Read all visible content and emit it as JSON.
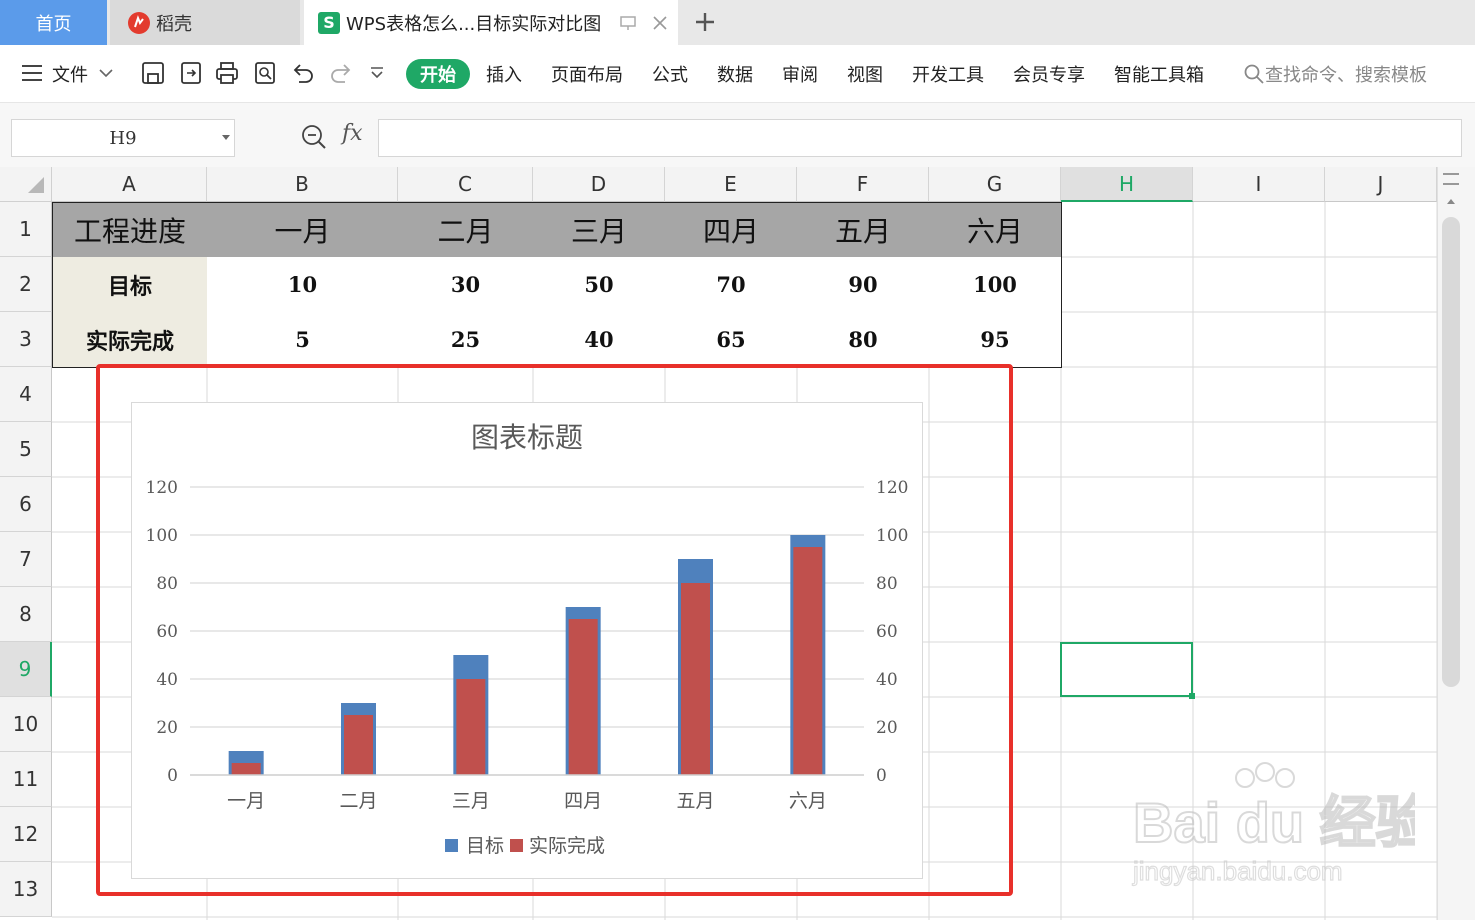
{
  "tabs": {
    "home": "首页",
    "daoke": "稻壳",
    "doc": "WPS表格怎么...目标实际对比图"
  },
  "menu": {
    "file": "文件",
    "start": "开始",
    "items": [
      "插入",
      "页面布局",
      "公式",
      "数据",
      "审阅",
      "视图",
      "开发工具",
      "会员专享",
      "智能工具箱"
    ],
    "search_placeholder": "查找命令、搜索模板"
  },
  "formula": {
    "cell_ref": "H9",
    "fx": "fx",
    "value": ""
  },
  "sheet": {
    "columns": [
      "A",
      "B",
      "C",
      "D",
      "E",
      "F",
      "G",
      "H",
      "I",
      "J"
    ],
    "active_column": "H",
    "rows": [
      "1",
      "2",
      "3",
      "4",
      "5",
      "6",
      "7",
      "8",
      "9",
      "10",
      "11",
      "12",
      "13"
    ],
    "active_row": "9",
    "table": {
      "header": [
        "工程进度",
        "一月",
        "二月",
        "三月",
        "四月",
        "五月",
        "六月"
      ],
      "target_label": "目标",
      "target": [
        "10",
        "30",
        "50",
        "70",
        "90",
        "100"
      ],
      "actual_label": "实际完成",
      "actual": [
        "5",
        "25",
        "40",
        "65",
        "80",
        "95"
      ]
    }
  },
  "colors": {
    "accent_green": "#1fa866",
    "target_series": "#4f81bd",
    "actual_series": "#c0504d",
    "highlight": "#e8302a"
  },
  "chart_data": {
    "type": "bar",
    "title": "图表标题",
    "categories": [
      "一月",
      "二月",
      "三月",
      "四月",
      "五月",
      "六月"
    ],
    "series": [
      {
        "name": "目标",
        "values": [
          10,
          30,
          50,
          70,
          90,
          100
        ],
        "axis": "primary"
      },
      {
        "name": "实际完成",
        "values": [
          5,
          25,
          40,
          65,
          80,
          95
        ],
        "axis": "secondary"
      }
    ],
    "ylim": [
      0,
      120
    ],
    "yticks": [
      0,
      20,
      40,
      60,
      80,
      100,
      120
    ],
    "ytick_labels": [
      "0",
      "20",
      "40",
      "60",
      "80",
      "100",
      "120"
    ],
    "y2lim": [
      0,
      120
    ],
    "grid": true,
    "legend": "bottom"
  },
  "watermark": {
    "brand": "Bai du 经验",
    "url": "jingyan.baidu.com"
  }
}
